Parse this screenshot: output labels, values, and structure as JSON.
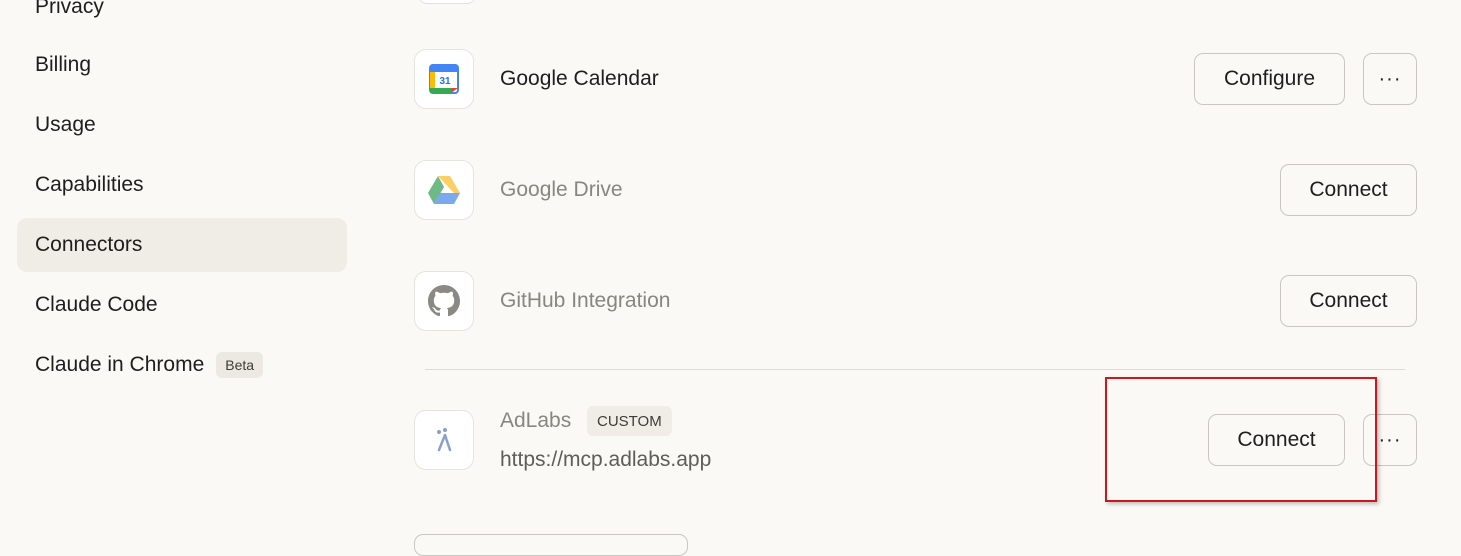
{
  "sidebar": {
    "items": [
      {
        "label": "Privacy",
        "active": false
      },
      {
        "label": "Billing",
        "active": false
      },
      {
        "label": "Usage",
        "active": false
      },
      {
        "label": "Capabilities",
        "active": false
      },
      {
        "label": "Connectors",
        "active": true
      },
      {
        "label": "Claude Code",
        "active": false
      },
      {
        "label": "Claude in Chrome",
        "active": false,
        "badge": "Beta"
      }
    ]
  },
  "connectors": [
    {
      "name": "Google Calendar",
      "icon": "google-calendar-icon",
      "icon_text": "31",
      "button": "Configure",
      "more": "···"
    },
    {
      "name": "Google Drive",
      "icon": "google-drive-icon",
      "button": "Connect"
    },
    {
      "name": "GitHub Integration",
      "icon": "github-icon",
      "button": "Connect"
    }
  ],
  "custom_connector": {
    "name": "AdLabs",
    "badge": "CUSTOM",
    "url": "https://mcp.adlabs.app",
    "icon": "adlabs-icon",
    "button": "Connect",
    "more": "···"
  },
  "colors": {
    "background": "#faf9f5",
    "active_nav": "#efede6",
    "highlight": "#d0161c"
  }
}
